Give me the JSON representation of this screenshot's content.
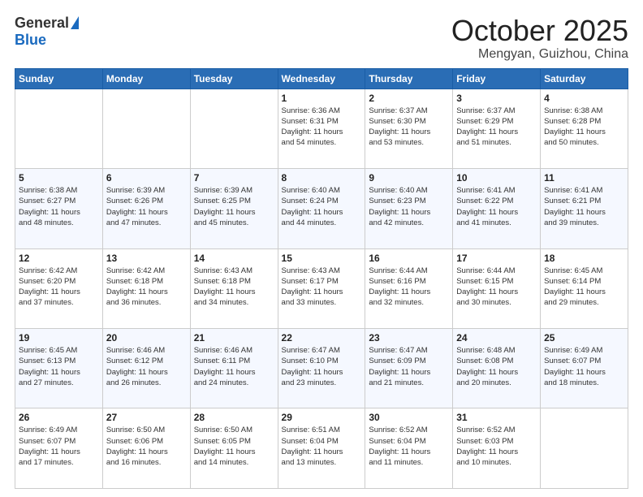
{
  "header": {
    "logo_general": "General",
    "logo_blue": "Blue",
    "month_title": "October 2025",
    "location": "Mengyan, Guizhou, China"
  },
  "days_of_week": [
    "Sunday",
    "Monday",
    "Tuesday",
    "Wednesday",
    "Thursday",
    "Friday",
    "Saturday"
  ],
  "weeks": [
    [
      {
        "day": "",
        "info": ""
      },
      {
        "day": "",
        "info": ""
      },
      {
        "day": "",
        "info": ""
      },
      {
        "day": "1",
        "info": "Sunrise: 6:36 AM\nSunset: 6:31 PM\nDaylight: 11 hours\nand 54 minutes."
      },
      {
        "day": "2",
        "info": "Sunrise: 6:37 AM\nSunset: 6:30 PM\nDaylight: 11 hours\nand 53 minutes."
      },
      {
        "day": "3",
        "info": "Sunrise: 6:37 AM\nSunset: 6:29 PM\nDaylight: 11 hours\nand 51 minutes."
      },
      {
        "day": "4",
        "info": "Sunrise: 6:38 AM\nSunset: 6:28 PM\nDaylight: 11 hours\nand 50 minutes."
      }
    ],
    [
      {
        "day": "5",
        "info": "Sunrise: 6:38 AM\nSunset: 6:27 PM\nDaylight: 11 hours\nand 48 minutes."
      },
      {
        "day": "6",
        "info": "Sunrise: 6:39 AM\nSunset: 6:26 PM\nDaylight: 11 hours\nand 47 minutes."
      },
      {
        "day": "7",
        "info": "Sunrise: 6:39 AM\nSunset: 6:25 PM\nDaylight: 11 hours\nand 45 minutes."
      },
      {
        "day": "8",
        "info": "Sunrise: 6:40 AM\nSunset: 6:24 PM\nDaylight: 11 hours\nand 44 minutes."
      },
      {
        "day": "9",
        "info": "Sunrise: 6:40 AM\nSunset: 6:23 PM\nDaylight: 11 hours\nand 42 minutes."
      },
      {
        "day": "10",
        "info": "Sunrise: 6:41 AM\nSunset: 6:22 PM\nDaylight: 11 hours\nand 41 minutes."
      },
      {
        "day": "11",
        "info": "Sunrise: 6:41 AM\nSunset: 6:21 PM\nDaylight: 11 hours\nand 39 minutes."
      }
    ],
    [
      {
        "day": "12",
        "info": "Sunrise: 6:42 AM\nSunset: 6:20 PM\nDaylight: 11 hours\nand 37 minutes."
      },
      {
        "day": "13",
        "info": "Sunrise: 6:42 AM\nSunset: 6:18 PM\nDaylight: 11 hours\nand 36 minutes."
      },
      {
        "day": "14",
        "info": "Sunrise: 6:43 AM\nSunset: 6:18 PM\nDaylight: 11 hours\nand 34 minutes."
      },
      {
        "day": "15",
        "info": "Sunrise: 6:43 AM\nSunset: 6:17 PM\nDaylight: 11 hours\nand 33 minutes."
      },
      {
        "day": "16",
        "info": "Sunrise: 6:44 AM\nSunset: 6:16 PM\nDaylight: 11 hours\nand 32 minutes."
      },
      {
        "day": "17",
        "info": "Sunrise: 6:44 AM\nSunset: 6:15 PM\nDaylight: 11 hours\nand 30 minutes."
      },
      {
        "day": "18",
        "info": "Sunrise: 6:45 AM\nSunset: 6:14 PM\nDaylight: 11 hours\nand 29 minutes."
      }
    ],
    [
      {
        "day": "19",
        "info": "Sunrise: 6:45 AM\nSunset: 6:13 PM\nDaylight: 11 hours\nand 27 minutes."
      },
      {
        "day": "20",
        "info": "Sunrise: 6:46 AM\nSunset: 6:12 PM\nDaylight: 11 hours\nand 26 minutes."
      },
      {
        "day": "21",
        "info": "Sunrise: 6:46 AM\nSunset: 6:11 PM\nDaylight: 11 hours\nand 24 minutes."
      },
      {
        "day": "22",
        "info": "Sunrise: 6:47 AM\nSunset: 6:10 PM\nDaylight: 11 hours\nand 23 minutes."
      },
      {
        "day": "23",
        "info": "Sunrise: 6:47 AM\nSunset: 6:09 PM\nDaylight: 11 hours\nand 21 minutes."
      },
      {
        "day": "24",
        "info": "Sunrise: 6:48 AM\nSunset: 6:08 PM\nDaylight: 11 hours\nand 20 minutes."
      },
      {
        "day": "25",
        "info": "Sunrise: 6:49 AM\nSunset: 6:07 PM\nDaylight: 11 hours\nand 18 minutes."
      }
    ],
    [
      {
        "day": "26",
        "info": "Sunrise: 6:49 AM\nSunset: 6:07 PM\nDaylight: 11 hours\nand 17 minutes."
      },
      {
        "day": "27",
        "info": "Sunrise: 6:50 AM\nSunset: 6:06 PM\nDaylight: 11 hours\nand 16 minutes."
      },
      {
        "day": "28",
        "info": "Sunrise: 6:50 AM\nSunset: 6:05 PM\nDaylight: 11 hours\nand 14 minutes."
      },
      {
        "day": "29",
        "info": "Sunrise: 6:51 AM\nSunset: 6:04 PM\nDaylight: 11 hours\nand 13 minutes."
      },
      {
        "day": "30",
        "info": "Sunrise: 6:52 AM\nSunset: 6:04 PM\nDaylight: 11 hours\nand 11 minutes."
      },
      {
        "day": "31",
        "info": "Sunrise: 6:52 AM\nSunset: 6:03 PM\nDaylight: 11 hours\nand 10 minutes."
      },
      {
        "day": "",
        "info": ""
      }
    ]
  ]
}
